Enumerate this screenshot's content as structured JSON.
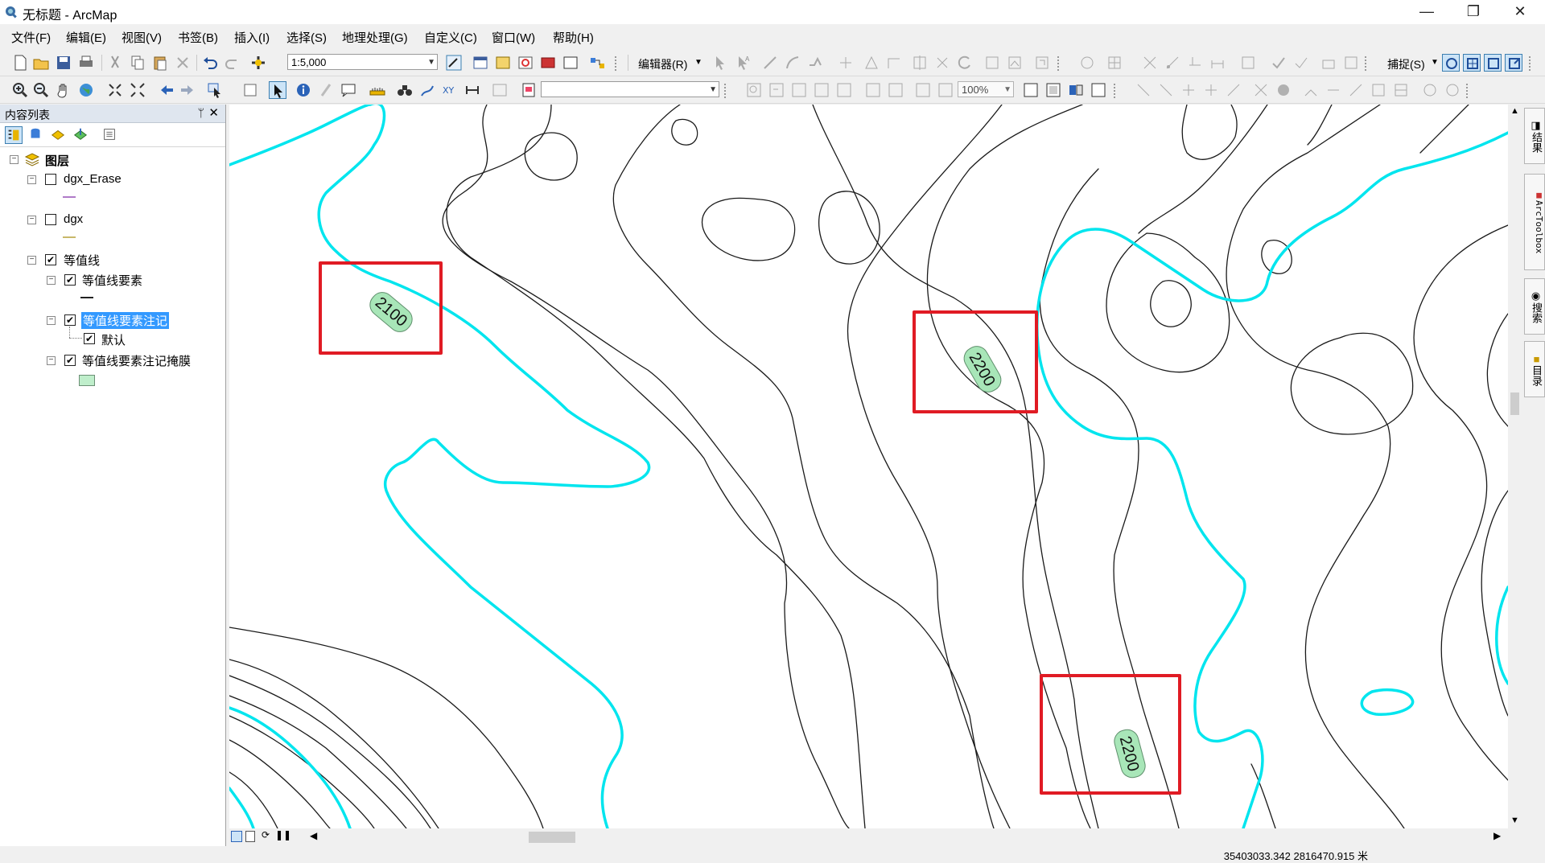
{
  "window": {
    "title": "无标题 - ArcMap",
    "minimize": "—",
    "restore": "❐",
    "close": "✕"
  },
  "menu": [
    "文件(F)",
    "编辑(E)",
    "视图(V)",
    "书签(B)",
    "插入(I)",
    "选择(S)",
    "地理处理(G)",
    "自定义(C)",
    "窗口(W)",
    "帮助(H)"
  ],
  "toolbar": {
    "scale_value": "1:5,000",
    "editor_label": "编辑器(R)",
    "snap_label": "捕捉(S)",
    "zoom_value": "100%"
  },
  "toc": {
    "title": "内容列表",
    "pin": "ᛘ",
    "close": "✕",
    "root": "图层",
    "layers": [
      {
        "name": "dgx_Erase",
        "checked": false
      },
      {
        "name": "dgx",
        "checked": false
      },
      {
        "name": "等值线",
        "checked": true
      },
      {
        "name": "等值线要素",
        "checked": true
      },
      {
        "name": "等值线要素注记",
        "checked": true
      },
      {
        "name": "默认",
        "checked": true
      },
      {
        "name": "等值线要素注记掩膜",
        "checked": true
      }
    ]
  },
  "map": {
    "labels": [
      "2100",
      "2200",
      "2200"
    ],
    "colors": {
      "index_contour": "#00e5ee",
      "contour": "#1a1a1a",
      "halo": "#a8e6b8",
      "highlight_box": "#e01b24"
    }
  },
  "right_dock": [
    "结果",
    "ArcToolbox",
    "搜索",
    "目录"
  ],
  "status": {
    "coordinates": "35403033.342  2816470.915 米"
  }
}
